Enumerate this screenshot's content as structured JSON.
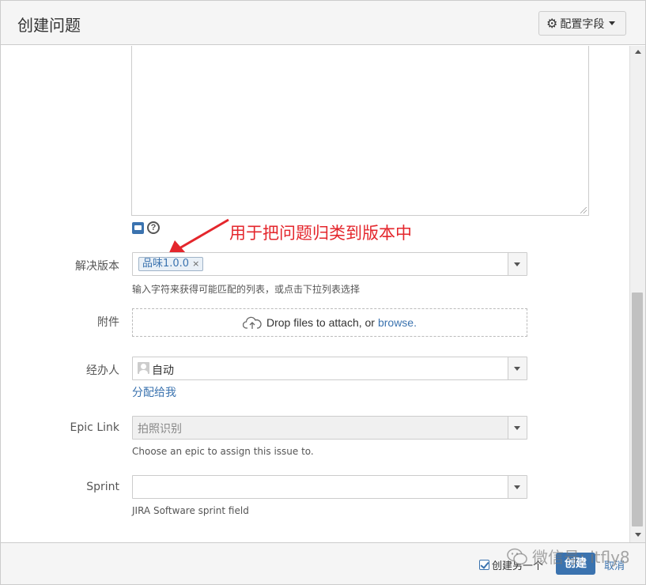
{
  "dialog": {
    "title": "创建问题",
    "config_fields_label": "配置字段"
  },
  "annotation": {
    "text": "用于把问题归类到版本中",
    "color": "#e4262c"
  },
  "fields": {
    "fix_version": {
      "label": "解决版本",
      "tag": "品味1.0.0",
      "tag_remove": "×",
      "hint": "输入字符来获得可能匹配的列表，或点击下拉列表选择"
    },
    "attachment": {
      "label": "附件",
      "drop_text": "Drop files to attach, or",
      "browse_text": "browse."
    },
    "assignee": {
      "label": "经办人",
      "value": "自动",
      "assign_to_me": "分配给我"
    },
    "epic_link": {
      "label": "Epic Link",
      "value": "拍照识别",
      "hint": "Choose an epic to assign this issue to."
    },
    "sprint": {
      "label": "Sprint",
      "value": "",
      "hint": "JIRA Software sprint field"
    }
  },
  "footer": {
    "create_another_label": "创建另一个",
    "create_another_checked": true,
    "create_button": "创建",
    "cancel_link": "取消"
  },
  "watermark": {
    "text": "微信号: itfly8"
  },
  "colors": {
    "accent": "#3b73af",
    "header_bg": "#f5f5f5"
  }
}
